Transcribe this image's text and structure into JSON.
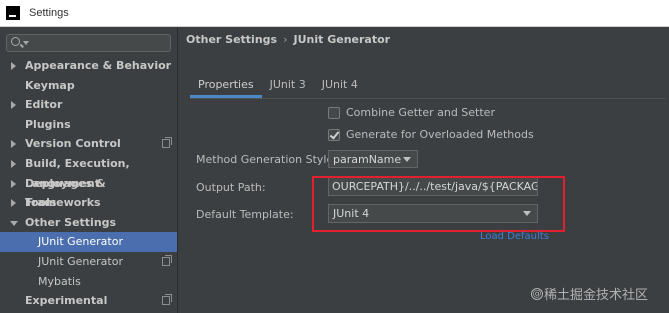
{
  "window": {
    "title": "Settings"
  },
  "sidebar": {
    "search_placeholder": "",
    "items": [
      {
        "label": "Appearance & Behavior",
        "expander": "right",
        "copy": false,
        "sub": false,
        "selected": false
      },
      {
        "label": "Keymap",
        "expander": "none",
        "copy": false,
        "sub": false,
        "selected": false
      },
      {
        "label": "Editor",
        "expander": "right",
        "copy": false,
        "sub": false,
        "selected": false
      },
      {
        "label": "Plugins",
        "expander": "none",
        "copy": false,
        "sub": false,
        "selected": false
      },
      {
        "label": "Version Control",
        "expander": "right",
        "copy": true,
        "sub": false,
        "selected": false
      },
      {
        "label": "Build, Execution, Deployment",
        "expander": "right",
        "copy": false,
        "sub": false,
        "selected": false
      },
      {
        "label": "Languages & Frameworks",
        "expander": "right",
        "copy": false,
        "sub": false,
        "selected": false
      },
      {
        "label": "Tools",
        "expander": "right",
        "copy": false,
        "sub": false,
        "selected": false
      },
      {
        "label": "Other Settings",
        "expander": "down",
        "copy": false,
        "sub": false,
        "selected": false
      },
      {
        "label": "JUnit Generator",
        "expander": "none",
        "copy": false,
        "sub": true,
        "selected": true
      },
      {
        "label": "JUnit Generator",
        "expander": "none",
        "copy": true,
        "sub": true,
        "selected": false
      },
      {
        "label": "Mybatis",
        "expander": "none",
        "copy": false,
        "sub": true,
        "selected": false
      },
      {
        "label": "Experimental",
        "expander": "none",
        "copy": true,
        "sub": false,
        "selected": false
      }
    ]
  },
  "main": {
    "breadcrumb": {
      "parent": "Other Settings",
      "separator": "›",
      "current": "JUnit Generator"
    },
    "tabs": [
      {
        "label": "Properties",
        "active": true
      },
      {
        "label": "JUnit 3",
        "active": false
      },
      {
        "label": "JUnit 4",
        "active": false
      }
    ],
    "combine_getter_setter": {
      "label": "Combine Getter and Setter",
      "checked": false
    },
    "generate_overloaded": {
      "label": "Generate for Overloaded Methods",
      "checked": true
    },
    "method_generation_style": {
      "label": "Method Generation Style:",
      "value": "paramName"
    },
    "output_path": {
      "label": "Output Path:",
      "value": "OURCEPATH}/../../test/java/${PACKAGE}/${FIL"
    },
    "default_template": {
      "label": "Default Template:",
      "value": "JUnit 4"
    },
    "load_defaults": "Load Defaults"
  },
  "watermark": {
    "badge": "@",
    "text": "稀土掘金技术社区"
  },
  "colors": {
    "accent": "#4b6eaf",
    "highlight": "#e5202e",
    "link": "#3e7fd8"
  }
}
